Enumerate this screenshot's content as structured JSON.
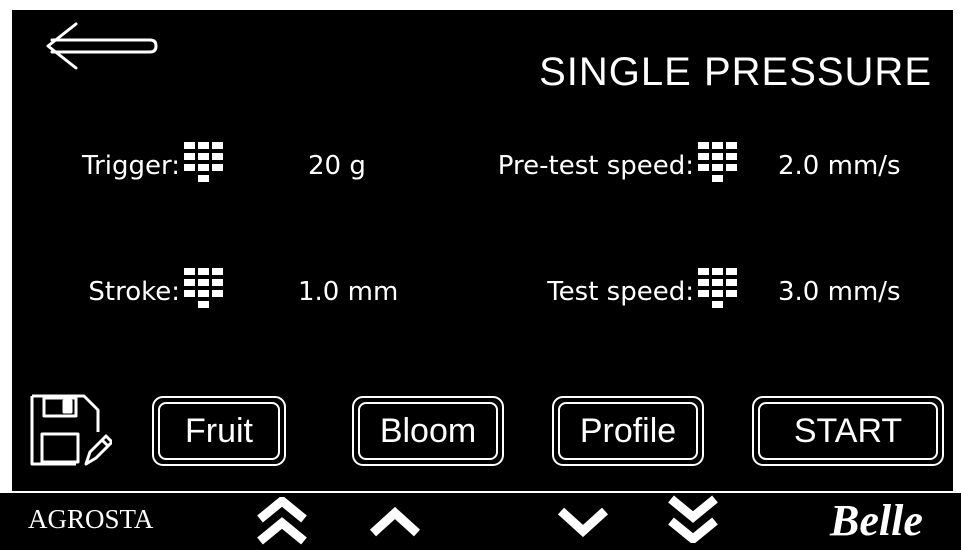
{
  "header": {
    "title": "SINGLE PRESSURE",
    "back_icon": "left-arrow-icon"
  },
  "params": {
    "trigger": {
      "label": "Trigger:",
      "value": "20 g",
      "icon": "keypad-icon"
    },
    "stroke": {
      "label": "Stroke:",
      "value": "1.0 mm",
      "icon": "keypad-icon"
    },
    "pretest_speed": {
      "label": "Pre-test speed:",
      "value": "2.0 mm/s",
      "icon": "keypad-icon"
    },
    "test_speed": {
      "label": "Test speed:",
      "value": "3.0 mm/s",
      "icon": "keypad-icon"
    }
  },
  "actions": {
    "save_icon": "save-edit-icon",
    "fruit": "Fruit",
    "bloom": "Bloom",
    "profile": "Profile",
    "start": "START"
  },
  "bottom": {
    "brand_left": "AGROSTA",
    "brand_right": "Belle",
    "nav_icons": [
      "double-chevron-up-icon",
      "chevron-up-icon",
      "chevron-down-icon",
      "double-chevron-down-icon"
    ]
  },
  "colors": {
    "background": "#000000",
    "foreground": "#ffffff",
    "frame": "#ffffff"
  }
}
